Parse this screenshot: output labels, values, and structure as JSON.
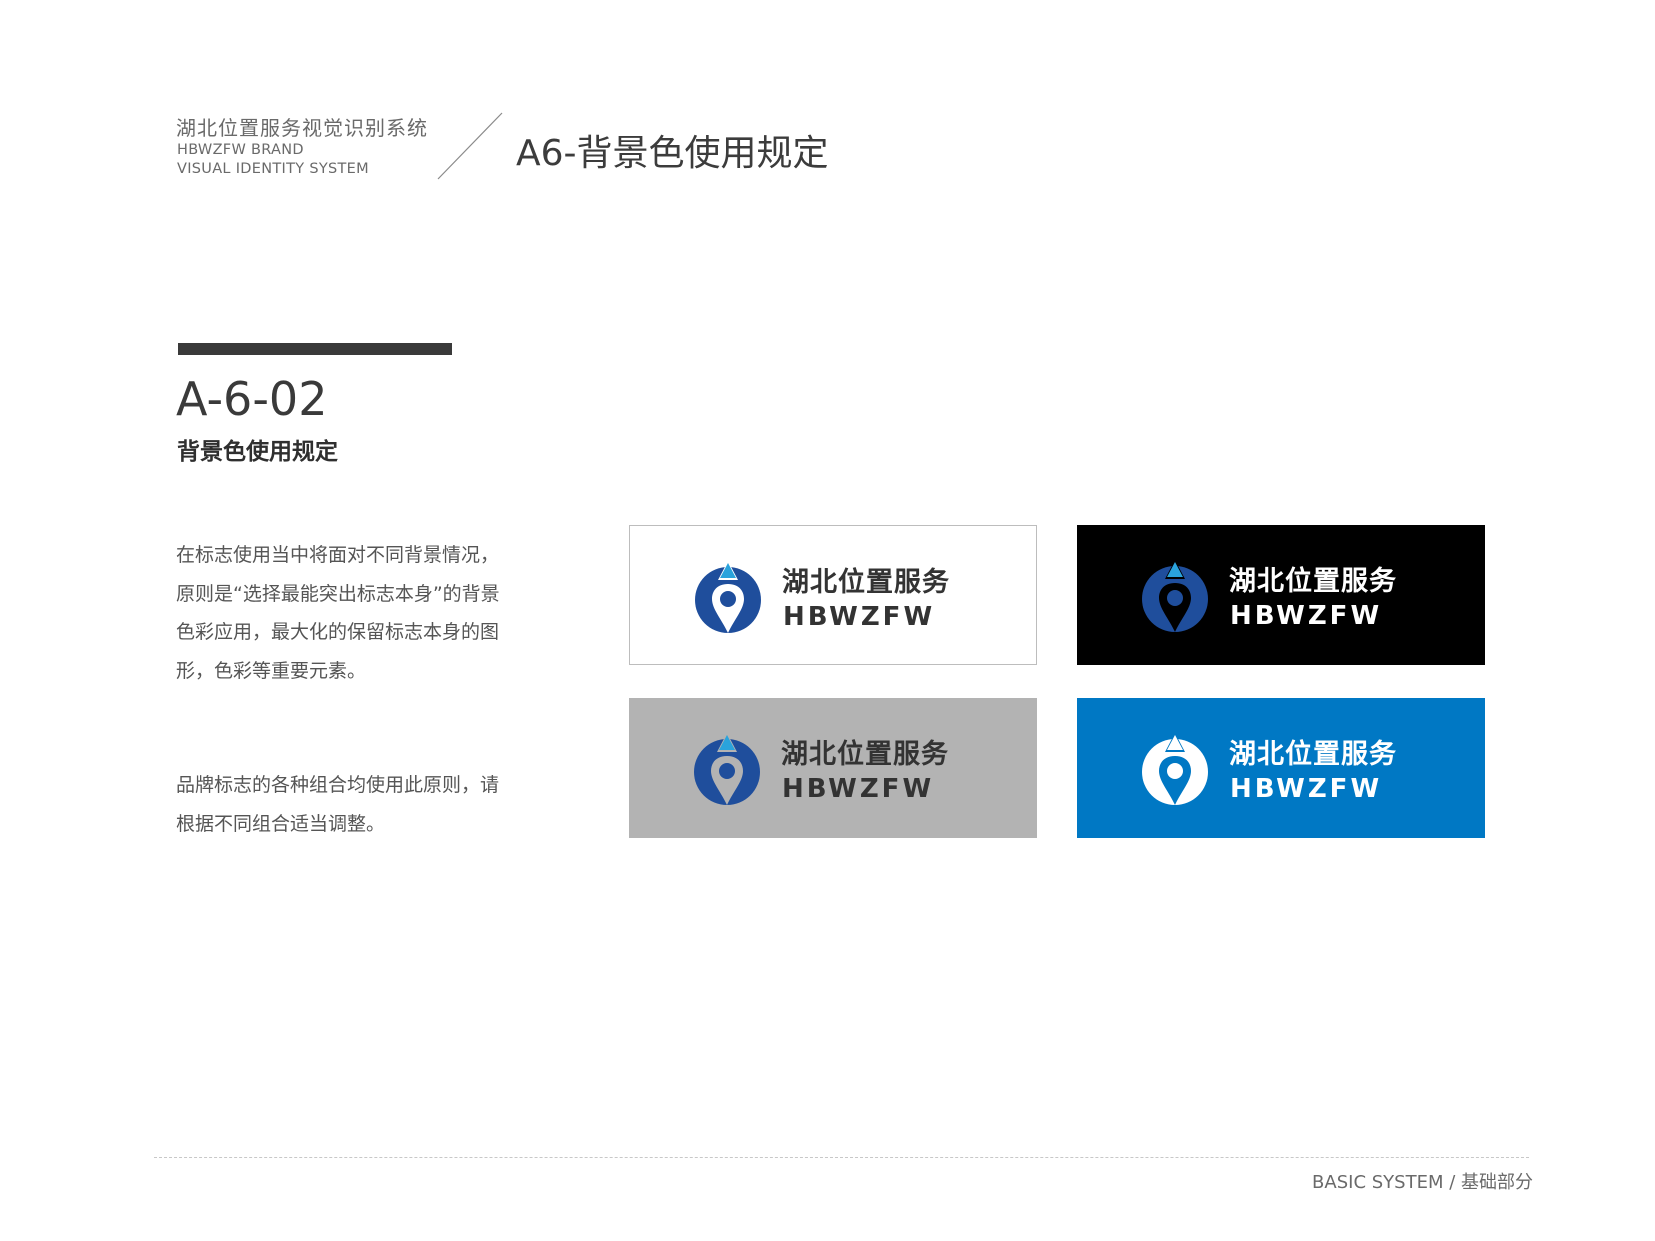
{
  "header": {
    "brand_cn": "湖北位置服务视觉识别系统",
    "brand_en_line1": "HBWZFW BRAND",
    "brand_en_line2": "VISUAL IDENTITY SYSTEM",
    "page_title": "A6-背景色使用规定"
  },
  "section": {
    "code": "A-6-02",
    "title": "背景色使用规定",
    "paragraphs": [
      "在标志使用当中将面对不同背景情况，原则是“选择最能突出标志本身”的背景色彩应用，最大化的保留标志本身的图形，色彩等重要元素。",
      "品牌标志的各种组合均使用此原则，请根据不同组合适当调整。"
    ]
  },
  "logo": {
    "name_cn": "湖北位置服务",
    "name_en": "HBWZFW",
    "brand_blue": "#1f4e9c",
    "accent_blue": "#2aa3dc"
  },
  "panels": [
    {
      "id": "white",
      "background": "#ffffff"
    },
    {
      "id": "black",
      "background": "#000000"
    },
    {
      "id": "gray",
      "background": "#b3b3b3"
    },
    {
      "id": "blue",
      "background": "#0078c4"
    }
  ],
  "footer": {
    "text": "BASIC SYSTEM / 基础部分"
  }
}
